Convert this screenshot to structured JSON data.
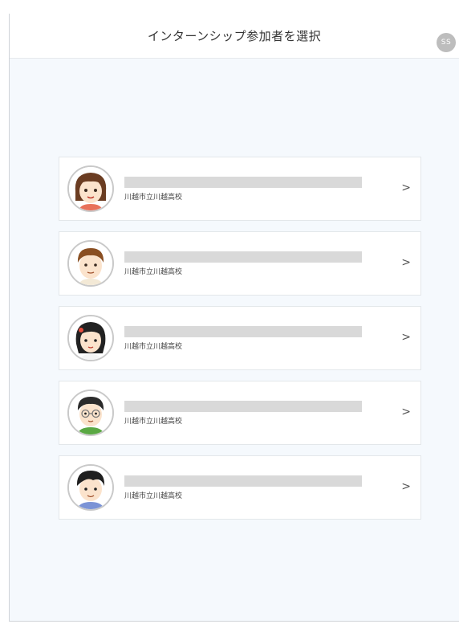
{
  "header": {
    "title": "インターンシップ参加者を選択",
    "user_initials": "SS"
  },
  "participants": [
    {
      "school": "川越市立川越高校",
      "avatar_icon": "girl-brown-hair-avatar-icon",
      "chevron": ">"
    },
    {
      "school": "川越市立川越高校",
      "avatar_icon": "boy-brown-hair-avatar-icon",
      "chevron": ">"
    },
    {
      "school": "川越市立川越高校",
      "avatar_icon": "girl-black-hair-hairclip-avatar-icon",
      "chevron": ">"
    },
    {
      "school": "川越市立川越高校",
      "avatar_icon": "boy-glasses-green-shirt-avatar-icon",
      "chevron": ">"
    },
    {
      "school": "川越市立川越高校",
      "avatar_icon": "boy-black-hair-blue-shirt-avatar-icon",
      "chevron": ">"
    }
  ],
  "colors": {
    "background": "#f5f9fd",
    "card": "#ffffff",
    "redacted_bar": "#d9d9d9",
    "badge": "#bdbdbd"
  }
}
